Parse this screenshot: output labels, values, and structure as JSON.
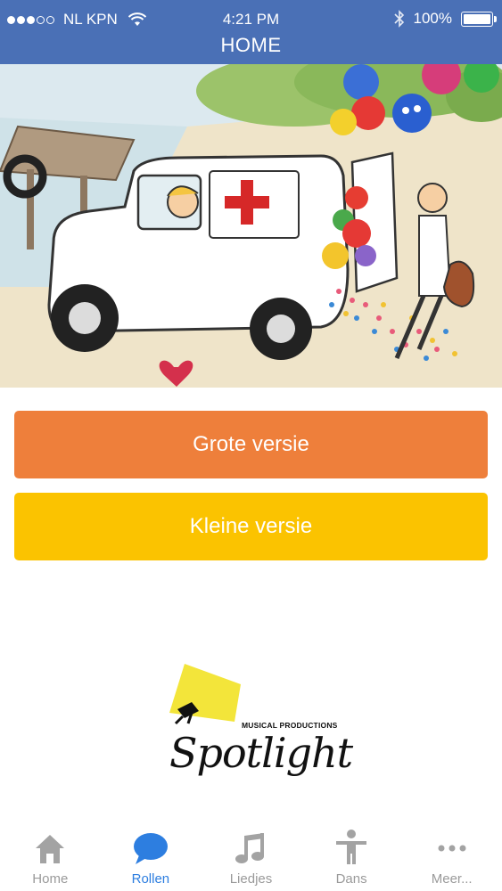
{
  "status_bar": {
    "carrier": "NL KPN",
    "time": "4:21 PM",
    "battery": "100%",
    "signal_icon": "signal-dots-icon",
    "wifi_icon": "wifi-icon",
    "bluetooth_icon": "bluetooth-icon",
    "battery_icon": "battery-icon"
  },
  "nav": {
    "title": "HOME",
    "background_color": "#4a70b6"
  },
  "hero": {
    "icon": "ambulance-illustration-icon"
  },
  "buttons": {
    "grote": {
      "label": "Grote versie",
      "color": "#ee7f3b"
    },
    "kleine": {
      "label": "Kleine versie",
      "color": "#fbc300"
    }
  },
  "logo": {
    "caption": "MUSICAL PRODUCTIONS",
    "word": "Spotlight"
  },
  "tabbar": {
    "active_color": "#2d7ee0",
    "items": [
      {
        "label": "Home",
        "icon": "home-icon",
        "active": false
      },
      {
        "label": "Rollen",
        "icon": "speech-bubble-icon",
        "active": true
      },
      {
        "label": "Liedjes",
        "icon": "music-note-icon",
        "active": false
      },
      {
        "label": "Dans",
        "icon": "person-icon",
        "active": false
      },
      {
        "label": "Meer...",
        "icon": "more-dots-icon",
        "active": false
      }
    ]
  }
}
